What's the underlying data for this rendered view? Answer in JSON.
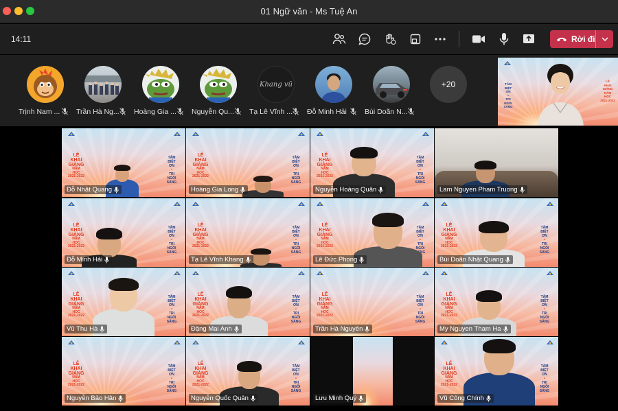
{
  "window": {
    "title": "01 Ngữ văn - Ms Tuệ An"
  },
  "toolbar": {
    "time": "14:11",
    "icons": [
      "people-icon",
      "chat-icon",
      "reactions-icon",
      "share-tray-icon",
      "more-icon",
      "camera-icon",
      "mic-icon",
      "share-screen-icon"
    ],
    "leave_label": "Rời đi",
    "leave_color": "#c4314b"
  },
  "strip": {
    "participants": [
      {
        "name": "Trịnh Nam ...",
        "avatar": "monkey-avatar"
      },
      {
        "name": "Trần Hà Ng...",
        "avatar": "group-photo-avatar"
      },
      {
        "name": "Hoàng Gia ...",
        "avatar": "frog-avatar"
      },
      {
        "name": "Nguyễn Qu...",
        "avatar": "frog-avatar"
      },
      {
        "name": "Tạ Lê Vĩnh ...",
        "avatar": "signature-avatar",
        "avatar_text": "Khang vũ"
      },
      {
        "name": "Đỗ Minh Hải",
        "avatar": "boy-photo-avatar"
      },
      {
        "name": "Bùi Doãn N...",
        "avatar": "car-photo-avatar"
      }
    ],
    "overflow_count": "+20"
  },
  "poster": {
    "left_lines": [
      "LỄ",
      "KHAI",
      "GIẢNG",
      "NĂM",
      "HỌC",
      "2021-2022"
    ],
    "right_lines": [
      "TÂM",
      "BIỆT",
      "ƠN",
      "•",
      "TRI",
      "NGÔI",
      "SÁNG"
    ]
  },
  "grid": [
    {
      "name": "Đỗ Nhật Quang"
    },
    {
      "name": "Hoàng Gia Long"
    },
    {
      "name": "Nguyễn Hoàng Quân"
    },
    {
      "name": "Lam Nguyen Pham Truong"
    },
    {
      "name": "Đỗ Minh Hải"
    },
    {
      "name": "Tạ Lê Vĩnh Khang"
    },
    {
      "name": "Lê Đức Phong"
    },
    {
      "name": "Bùi Doãn Nhật Quang"
    },
    {
      "name": "Vũ Thu Hà"
    },
    {
      "name": "Đặng Mai Anh"
    },
    {
      "name": "Trần Hà Nguyên"
    },
    {
      "name": "My Nguyen Tham Ha"
    },
    {
      "name": "Nguyễn Bảo Hân"
    },
    {
      "name": "Nguyễn Quốc Quân"
    },
    {
      "name": "Lưu Minh Quý"
    },
    {
      "name": "Vũ Công Chính"
    }
  ]
}
